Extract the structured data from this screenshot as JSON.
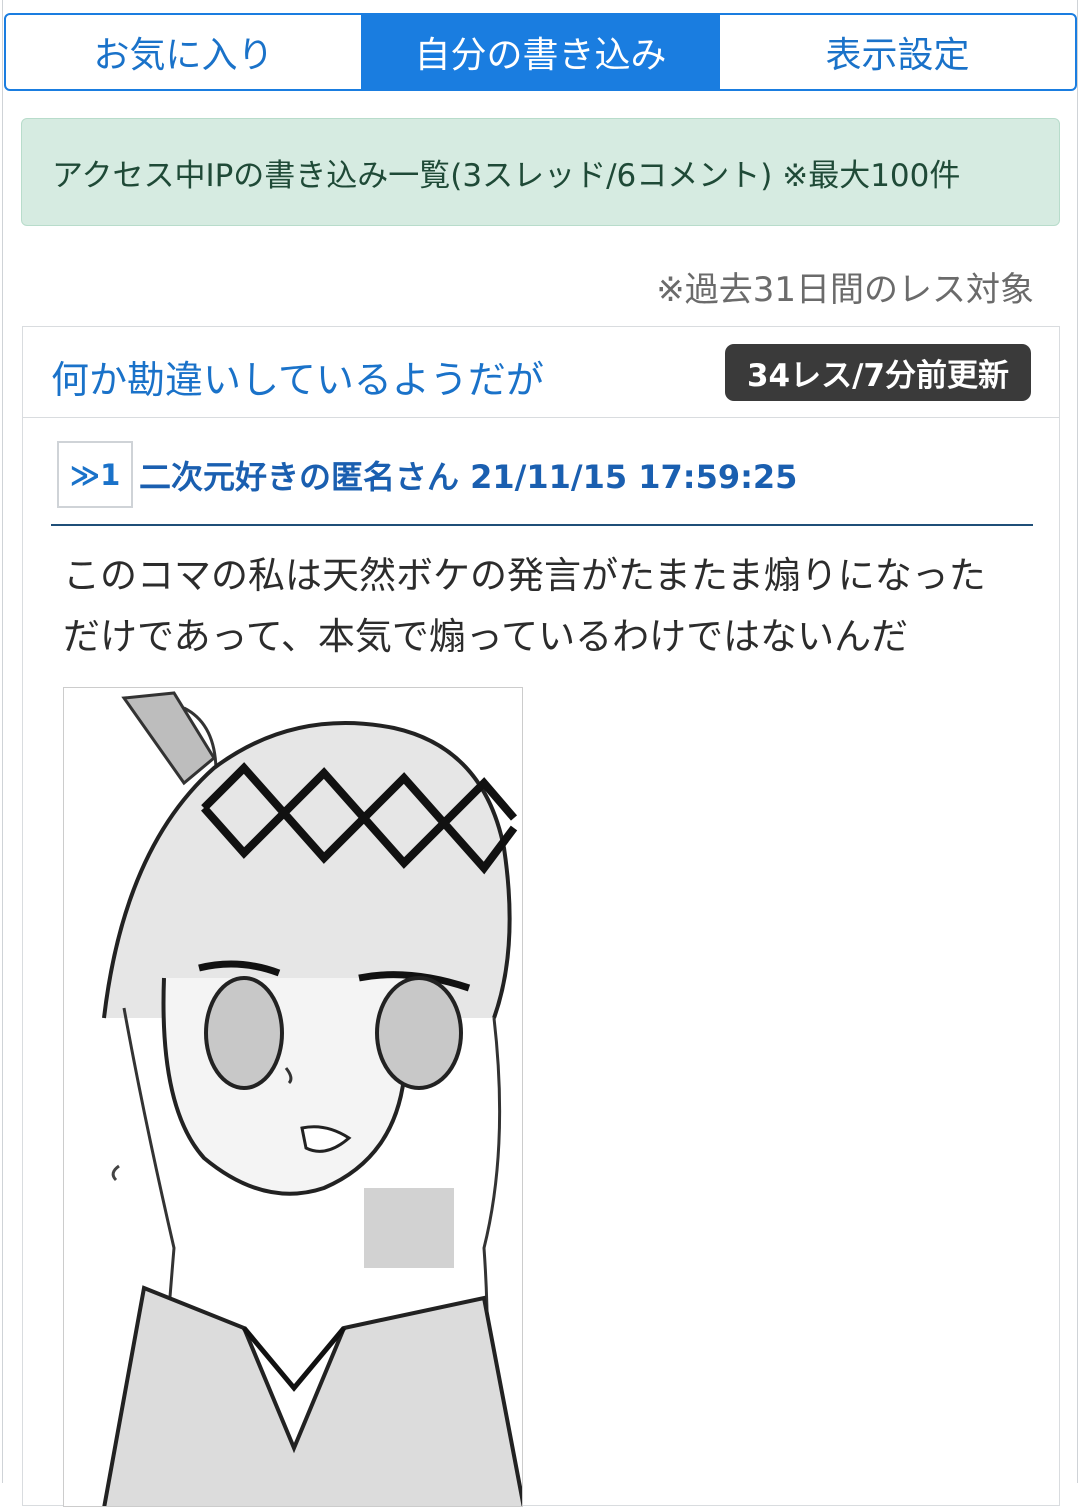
{
  "tabs": [
    {
      "label": "お気に入り",
      "active": false
    },
    {
      "label": "自分の書き込み",
      "active": true
    },
    {
      "label": "表示設定",
      "active": false
    }
  ],
  "info": {
    "summary": "アクセス中IPの書き込み一覧(3スレッド/6コメント) ※最大100件",
    "note": "※過去31日間のレス対象"
  },
  "thread": {
    "title": "何か勘違いしているようだが",
    "badge": "34レス/7分前更新",
    "post": {
      "number": "≫1",
      "author_date": "二次元好きの匿名さん 21/11/15 17:59:25",
      "body_line1": "このコマの私は天然ボケの発言がたまたま煽りになった",
      "body_line2": "だけであって、本気で煽っているわけではないんだ",
      "image": "manga-panel-image"
    }
  },
  "colors": {
    "accent": "#1a7de0",
    "link": "#1a72c9",
    "alert_bg": "#d6ebe1",
    "badge_bg": "#3a3a3a"
  }
}
